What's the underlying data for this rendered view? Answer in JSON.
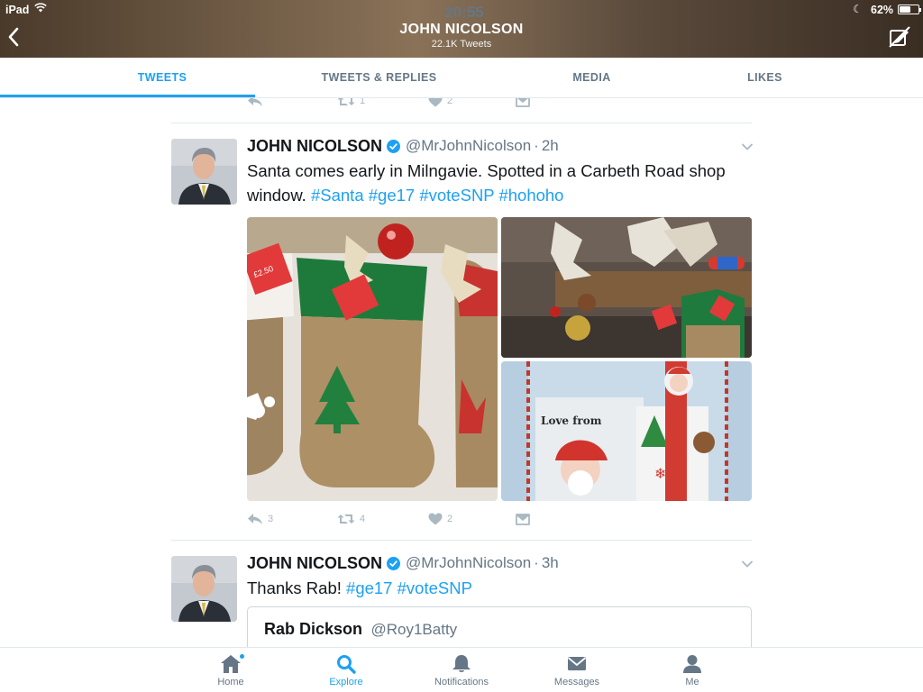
{
  "status_bar": {
    "carrier": "iPad",
    "time": "20:55",
    "battery_percent": "62%",
    "battery_level": 0.62
  },
  "header": {
    "title": "JOHN NICOLSON",
    "subtitle": "22.1K Tweets",
    "back_icon": "chevron-left-icon",
    "right_icon": "compose-off-icon"
  },
  "tabs": [
    {
      "label": "TWEETS",
      "active": true
    },
    {
      "label": "TWEETS & REPLIES",
      "active": false
    },
    {
      "label": "MEDIA",
      "active": false
    },
    {
      "label": "LIKES",
      "active": false
    }
  ],
  "feed": {
    "previous_tweet_actions": {
      "retweets": "1",
      "likes": "2"
    },
    "tweets": [
      {
        "name": "JOHN NICOLSON",
        "handle": "@MrJohnNicolson",
        "sep": "·",
        "time": "2h",
        "text_plain": "Santa comes early in Milngavie. Spotted in a Carbeth Road shop window.",
        "hashtags": [
          "#Santa",
          "#ge17",
          "#voteSNP",
          "#hohoho"
        ],
        "photo_tags": {
          "left": "£2.50",
          "bottom_right": "Love from"
        },
        "replies": "3",
        "retweets": "4",
        "likes": "2"
      },
      {
        "name": "JOHN NICOLSON",
        "handle": "@MrJohnNicolson",
        "sep": "·",
        "time": "3h",
        "text_plain": "Thanks Rab!",
        "hashtags": [
          "#ge17",
          "#voteSNP"
        ],
        "quote": {
          "name": "Rab Dickson",
          "handle": "@Roy1Batty"
        }
      }
    ]
  },
  "bottom_nav": [
    {
      "label": "Home",
      "icon": "home-icon",
      "active": false,
      "badge": true
    },
    {
      "label": "Explore",
      "icon": "search-icon",
      "active": true,
      "badge": false
    },
    {
      "label": "Notifications",
      "icon": "bell-icon",
      "active": false,
      "badge": false
    },
    {
      "label": "Messages",
      "icon": "envelope-icon",
      "active": false,
      "badge": false
    },
    {
      "label": "Me",
      "icon": "person-icon",
      "active": false,
      "badge": false
    }
  ],
  "colors": {
    "accent": "#1da1f2",
    "text": "#14171a",
    "secondary": "#657786",
    "icon_gray": "#aab8c2",
    "divider": "#e1e8ed"
  }
}
